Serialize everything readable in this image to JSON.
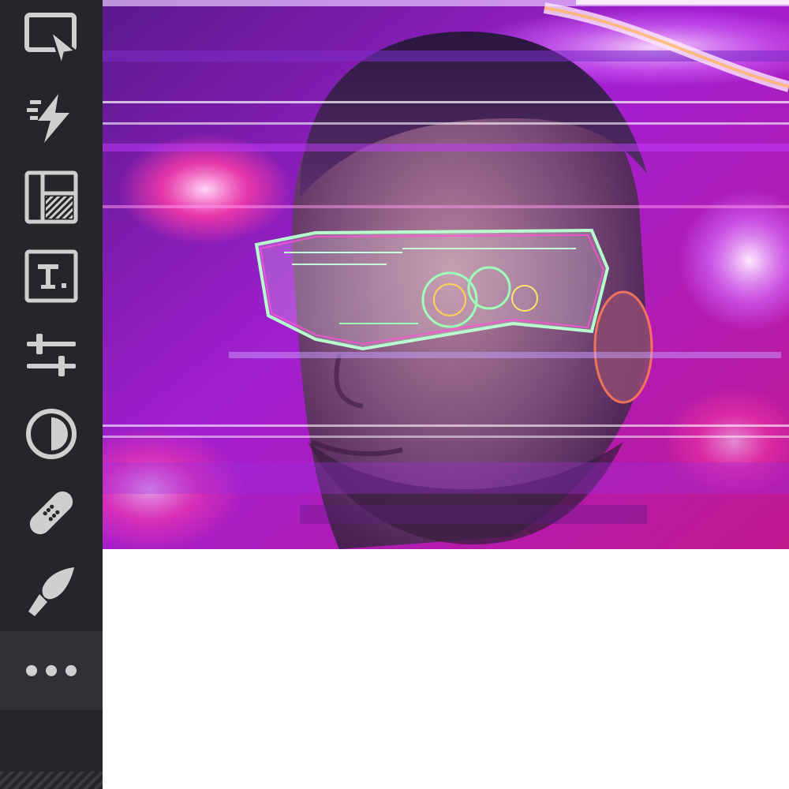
{
  "toolbar": {
    "tools": [
      {
        "name": "select-tool",
        "icon": "cursor-select-icon"
      },
      {
        "name": "quick-actions-tool",
        "icon": "lightning-icon"
      },
      {
        "name": "layout-tool",
        "icon": "layout-icon"
      },
      {
        "name": "text-tool",
        "icon": "text-box-icon"
      },
      {
        "name": "adjust-tool",
        "icon": "sliders-icon"
      },
      {
        "name": "contrast-tool",
        "icon": "contrast-icon"
      },
      {
        "name": "heal-tool",
        "icon": "bandage-icon"
      },
      {
        "name": "brush-tool",
        "icon": "brush-icon"
      },
      {
        "name": "more-tool",
        "icon": "more-dots-icon"
      }
    ]
  },
  "canvas": {
    "image": "glitch-portrait-neon-visor"
  },
  "colors": {
    "toolbar_bg": "#24262a",
    "icon_color": "#cfcfcf",
    "canvas_accent": "#d23cff"
  }
}
